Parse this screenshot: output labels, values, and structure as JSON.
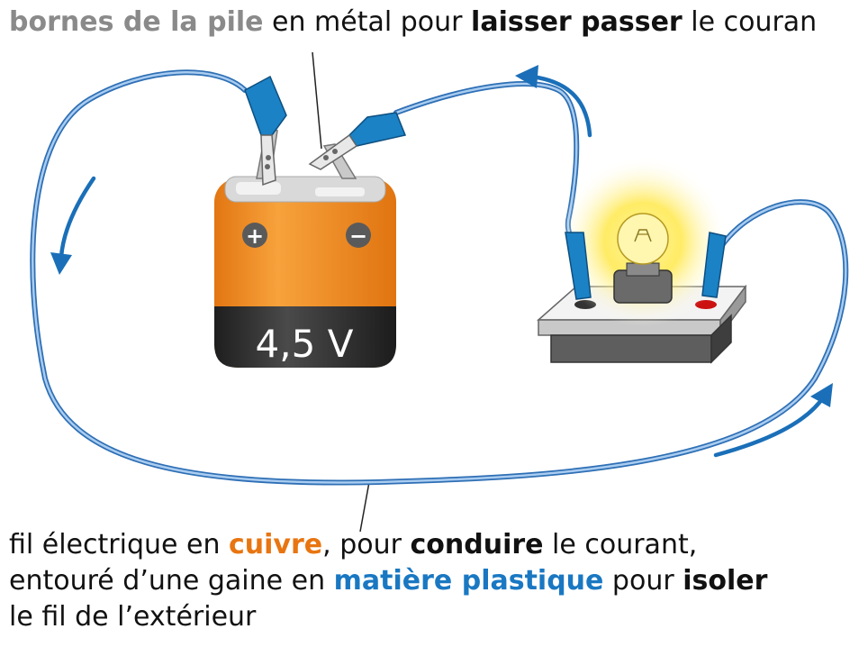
{
  "top_caption": {
    "part1": "bornes de la pile",
    "part2": " en métal pour ",
    "part3": "laisser passer",
    "part4": " le couran"
  },
  "battery": {
    "voltage_label": "4,5 V",
    "plus_symbol": "+",
    "minus_symbol": "−"
  },
  "bottom_caption": {
    "line1_a": "fil électrique en ",
    "line1_b": "cuivre",
    "line1_c": ", pour ",
    "line1_d": "conduire",
    "line1_e": " le courant,",
    "line2_a": "entouré d’une gaine en ",
    "line2_b": "matière plastique",
    "line2_c": " pour ",
    "line2_d": "isoler",
    "line3": "le fil de l’extérieur"
  },
  "colors": {
    "wire": "#6fa3dc",
    "arrow": "#1a6fb8",
    "battery_orange": "#f08a1c",
    "battery_dark": "#2b2b2b",
    "clip_blue": "#1b82c6",
    "bulb_glow": "#ffe84a"
  }
}
